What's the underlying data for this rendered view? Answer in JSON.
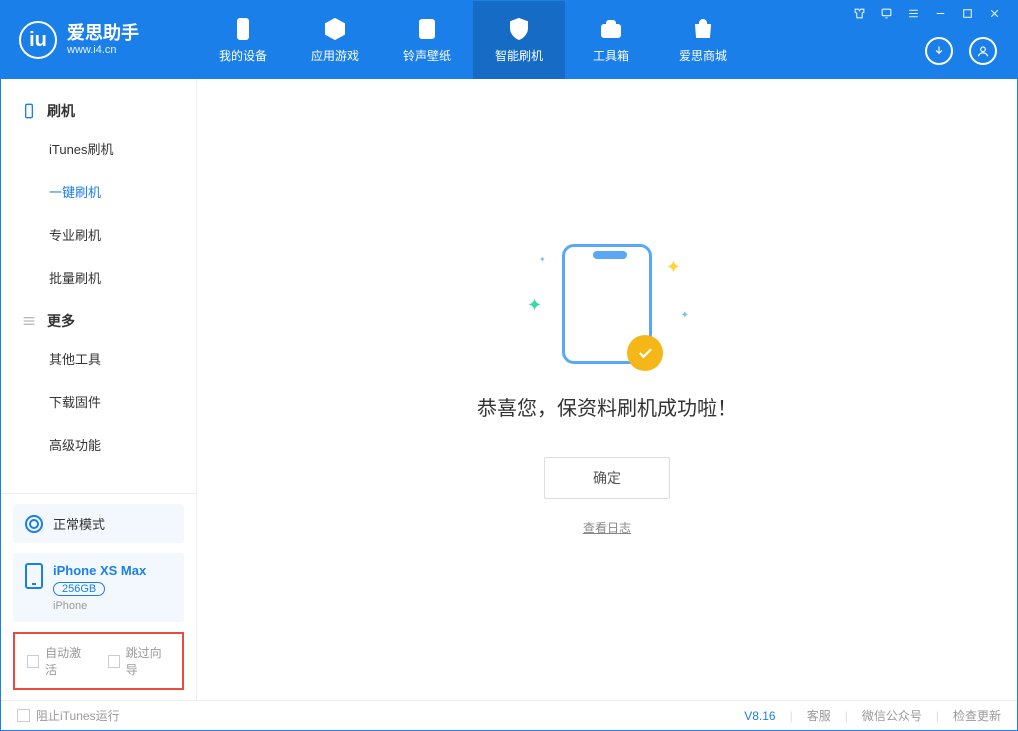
{
  "app": {
    "title": "爱思助手",
    "subtitle": "www.i4.cn"
  },
  "nav": {
    "items": [
      {
        "label": "我的设备"
      },
      {
        "label": "应用游戏"
      },
      {
        "label": "铃声壁纸"
      },
      {
        "label": "智能刷机"
      },
      {
        "label": "工具箱"
      },
      {
        "label": "爱思商城"
      }
    ]
  },
  "sidebar": {
    "sections": [
      {
        "title": "刷机",
        "items": [
          {
            "label": "iTunes刷机"
          },
          {
            "label": "一键刷机"
          },
          {
            "label": "专业刷机"
          },
          {
            "label": "批量刷机"
          }
        ]
      },
      {
        "title": "更多",
        "items": [
          {
            "label": "其他工具"
          },
          {
            "label": "下载固件"
          },
          {
            "label": "高级功能"
          }
        ]
      }
    ],
    "mode_label": "正常模式",
    "device": {
      "name": "iPhone XS Max",
      "storage": "256GB",
      "type": "iPhone"
    },
    "options": {
      "auto_activate": "自动激活",
      "skip_guide": "跳过向导"
    }
  },
  "main": {
    "success_msg": "恭喜您，保资料刷机成功啦！",
    "ok_button": "确定",
    "view_log": "查看日志"
  },
  "footer": {
    "block_itunes": "阻止iTunes运行",
    "version": "V8.16",
    "links": {
      "service": "客服",
      "wechat": "微信公众号",
      "update": "检查更新"
    }
  }
}
